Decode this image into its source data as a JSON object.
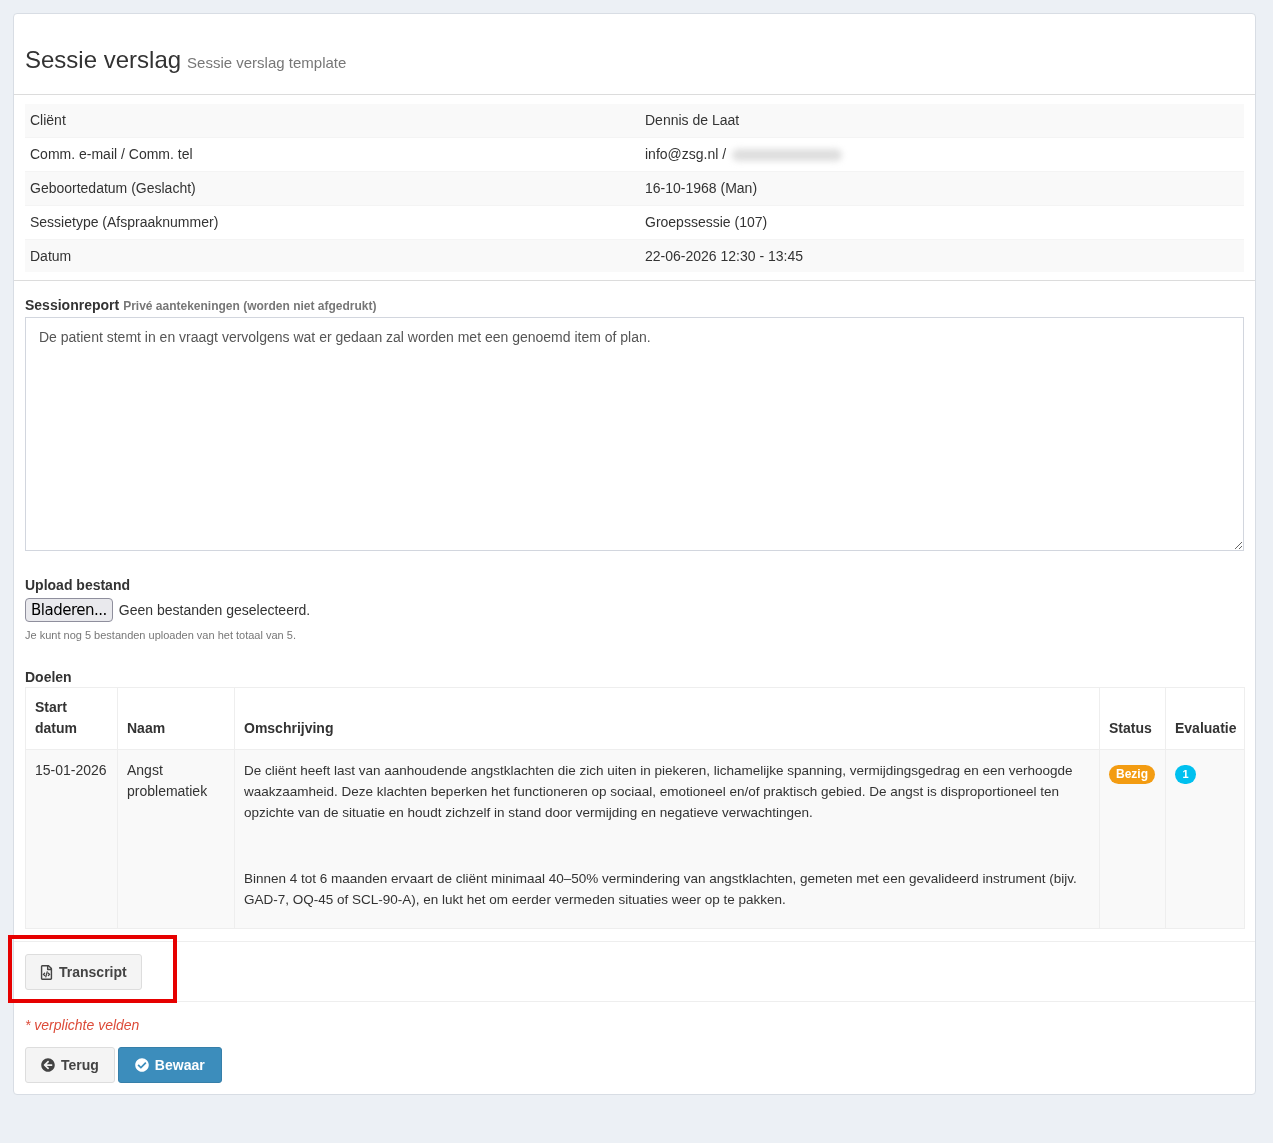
{
  "page": {
    "title": "Sessie verslag",
    "subtitle": "Sessie verslag template"
  },
  "info_rows": [
    {
      "label": "Cliënt",
      "value": "Dennis de Laat",
      "value_blurred": false
    },
    {
      "label": "Comm. e-mail / Comm. tel",
      "value": "info@zsg.nl /",
      "value_blurred": true
    },
    {
      "label": "Geboortedatum (Geslacht)",
      "value": "16-10-1968 (Man)",
      "value_blurred": false
    },
    {
      "label": "Sessietype (Afspraaknummer)",
      "value": "Groepssessie (107)",
      "value_blurred": false
    },
    {
      "label": "Datum",
      "value": "22-06-2026 12:30 - 13:45",
      "value_blurred": false
    }
  ],
  "session_report": {
    "label": "Sessionreport",
    "note": "Privé aantekeningen (worden niet afgedrukt)",
    "value": "De patient stemt in en vraagt vervolgens wat er gedaan zal worden met een genoemd item of plan."
  },
  "upload": {
    "label": "Upload bestand",
    "button": "Bladeren...",
    "status": "Geen bestanden geselecteerd.",
    "help": "Je kunt nog 5 bestanden uploaden van het totaal van 5."
  },
  "goals": {
    "title": "Doelen",
    "columns": [
      "Start datum",
      "Naam",
      "Omschrijving",
      "Status",
      "Evaluatie"
    ],
    "rows": [
      {
        "start_date": "15-01-2026",
        "name": "Angst problematiek",
        "description": [
          "De cliënt heeft last van aanhoudende angstklachten die zich uiten in piekeren, lichamelijke spanning, vermijdingsgedrag en een verhoogde waakzaamheid. Deze klachten beperken het functioneren op sociaal, emotioneel en/of praktisch gebied. De angst is disproportioneel ten opzichte van de situatie en houdt zichzelf in stand door vermijding en negatieve verwachtingen.",
          "Binnen 4 tot 6 maanden ervaart de cliënt minimaal 40–50% vermindering van angstklachten, gemeten met een gevalideerd instrument (bijv. GAD-7, OQ-45 of SCL-90-A), en lukt het om eerder vermeden situaties weer op te pakken."
        ],
        "status": {
          "label": "Bezig",
          "color": "#f39c12"
        },
        "evaluation": "1"
      }
    ]
  },
  "transcript_button": {
    "label": "Transcript",
    "highlighted": true
  },
  "required_note": "* verplichte velden",
  "buttons": [
    {
      "kind": "back",
      "label": "Terug"
    },
    {
      "kind": "save",
      "label": "Bewaar"
    }
  ]
}
